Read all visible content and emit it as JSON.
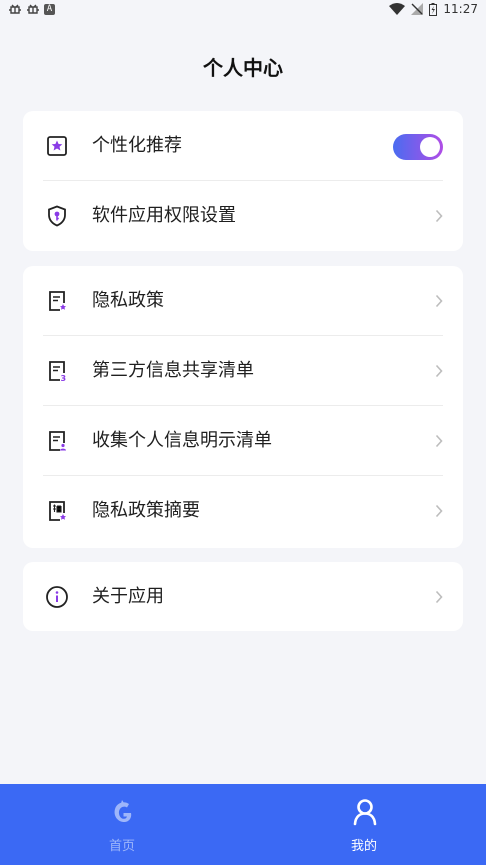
{
  "status_bar": {
    "time": "11:27",
    "left_icons": [
      "bug-icon",
      "bug-icon",
      "a-notification-icon"
    ],
    "right_icons": [
      "wifi-icon",
      "no-signal-icon",
      "battery-icon"
    ]
  },
  "header": {
    "title": "个人中心"
  },
  "section1": {
    "personalized": {
      "label": "个性化推荐",
      "toggle_on": true
    },
    "permissions": {
      "label": "软件应用权限设置"
    }
  },
  "section2": {
    "items": [
      {
        "label": "隐私政策"
      },
      {
        "label": "第三方信息共享清单"
      },
      {
        "label": "收集个人信息明示清单"
      },
      {
        "label": "隐私政策摘要"
      }
    ]
  },
  "section3": {
    "about": {
      "label": "关于应用"
    }
  },
  "tabbar": {
    "home": {
      "label": "首页"
    },
    "mine": {
      "label": "我的"
    }
  },
  "colors": {
    "accent": "#3b69f4",
    "toggle_start": "#4a6cf0",
    "toggle_end": "#b04de6",
    "icon_purple": "#8a3be6"
  }
}
